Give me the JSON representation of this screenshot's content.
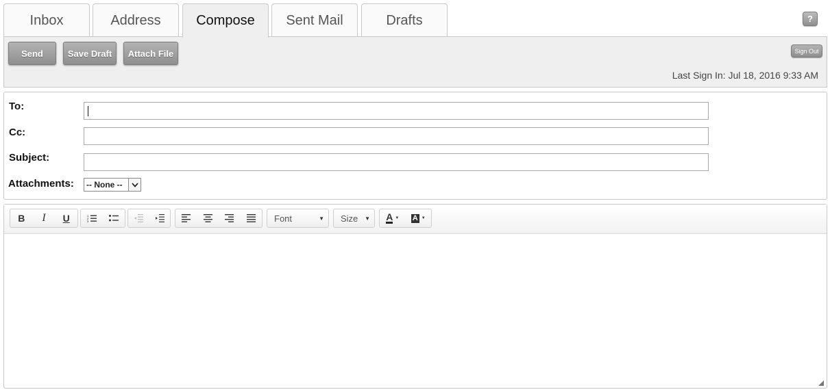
{
  "tabs": [
    {
      "label": "Inbox"
    },
    {
      "label": "Address"
    },
    {
      "label": "Compose"
    },
    {
      "label": "Sent Mail"
    },
    {
      "label": "Drafts"
    }
  ],
  "help": {
    "label": "?"
  },
  "toolbar": {
    "send_label": "Send",
    "save_draft_label": "Save Draft",
    "attach_file_label": "Attach File",
    "sign_out_label": "Sign Out",
    "last_sign_in": "Last Sign In: Jul 18, 2016 9:33 AM"
  },
  "form": {
    "to_label": "To:",
    "to_value": "",
    "cc_label": "Cc:",
    "cc_value": "",
    "subject_label": "Subject:",
    "subject_value": "",
    "attachments_label": "Attachments:",
    "attachments_selected": "-- None --"
  },
  "editor": {
    "bold": "B",
    "italic": "I",
    "underline": "U",
    "font_label": "Font",
    "size_label": "Size",
    "text_color": "A",
    "bg_color": "A",
    "body_text": ""
  },
  "icons": {
    "bold": "bold-icon",
    "italic": "italic-icon",
    "underline": "underline-icon",
    "ordered_list": "ordered-list-icon",
    "bullet_list": "bullet-list-icon",
    "outdent": "outdent-icon",
    "indent": "indent-icon",
    "align_left": "align-left-icon",
    "align_center": "align-center-icon",
    "align_right": "align-right-icon",
    "justify": "justify-icon"
  }
}
